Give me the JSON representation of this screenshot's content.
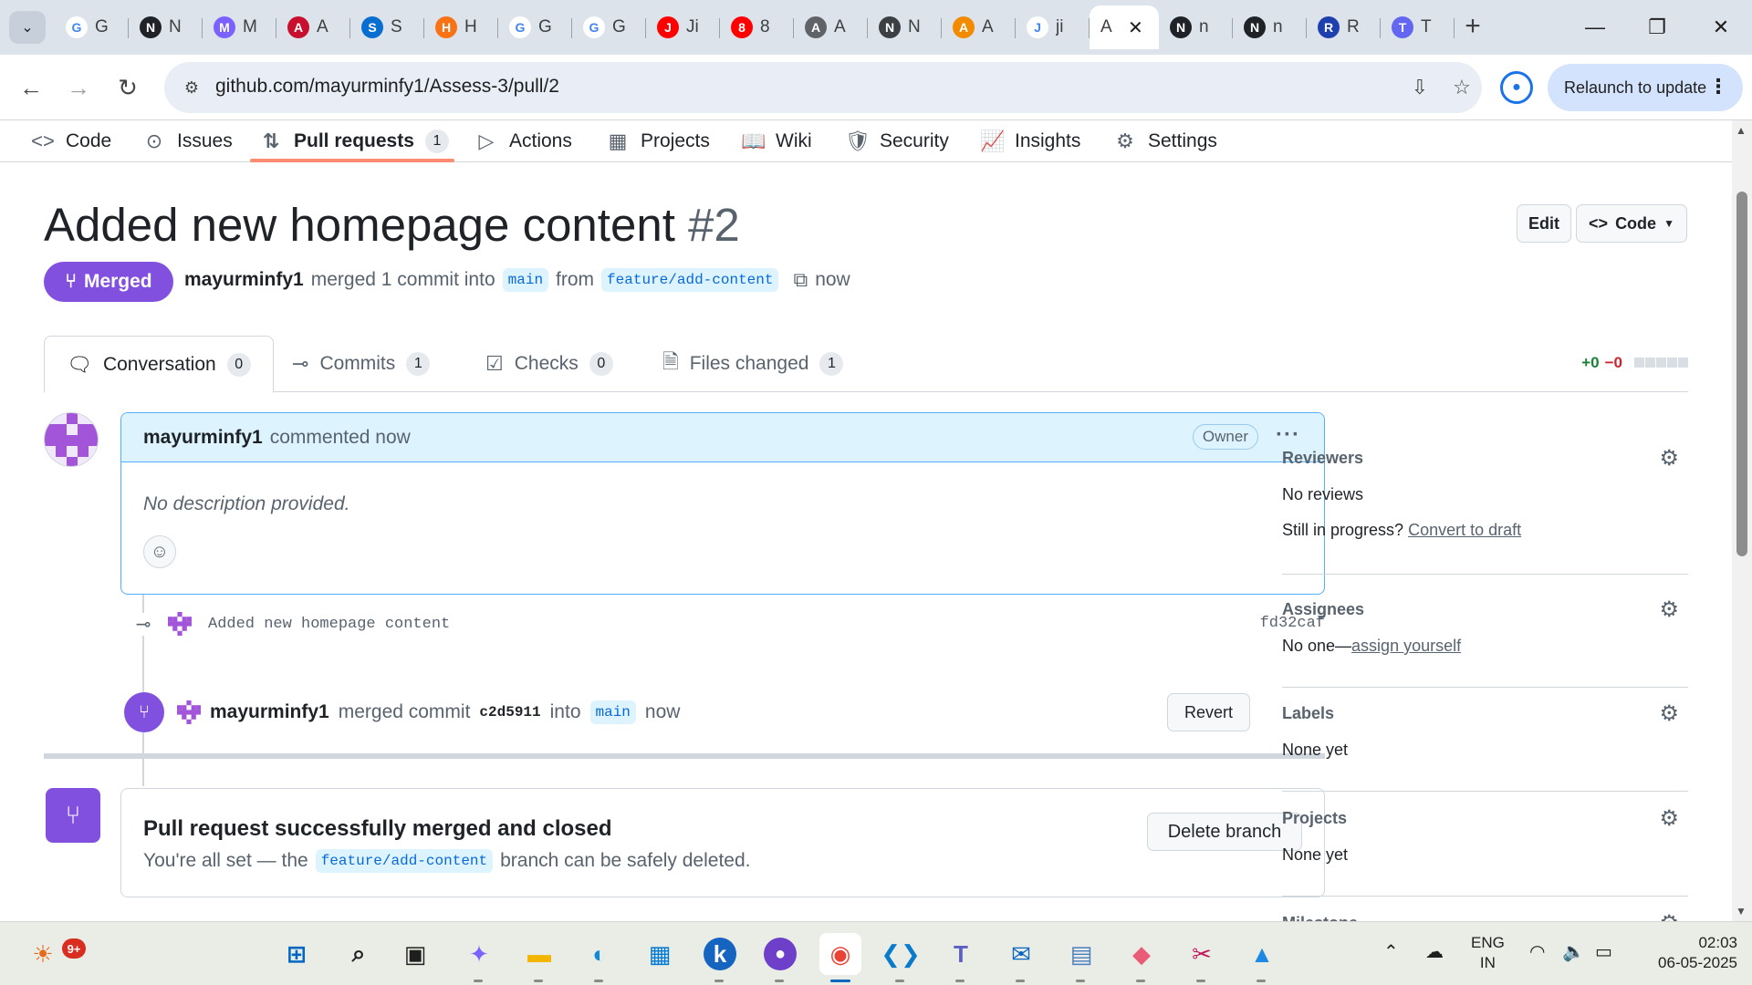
{
  "browser": {
    "tabs": [
      {
        "title": "G",
        "icon": "google-icon",
        "color": "#ffffff",
        "fg": "#4285f4"
      },
      {
        "title": "N",
        "icon": "github-icon",
        "color": "#1f2328",
        "fg": "#ffffff"
      },
      {
        "title": "M",
        "icon": "copilot-icon",
        "color": "#7b61ff",
        "fg": "#ffffff"
      },
      {
        "title": "A",
        "icon": "app-icon",
        "color": "#c8102e",
        "fg": "#ffffff"
      },
      {
        "title": "S",
        "icon": "diamond-icon",
        "color": "#0a6ed1",
        "fg": "#ffffff"
      },
      {
        "title": "H",
        "icon": "flame-icon",
        "color": "#f97316",
        "fg": "#ffffff"
      },
      {
        "title": "G",
        "icon": "google-icon",
        "color": "#ffffff",
        "fg": "#4285f4"
      },
      {
        "title": "G",
        "icon": "google-icon",
        "color": "#ffffff",
        "fg": "#4285f4"
      },
      {
        "title": "Ji",
        "icon": "youtube-icon",
        "color": "#ff0000",
        "fg": "#ffffff"
      },
      {
        "title": "8",
        "icon": "youtube-icon",
        "color": "#ff0000",
        "fg": "#ffffff"
      },
      {
        "title": "A",
        "icon": "globe-icon",
        "color": "#5f6368",
        "fg": "#ffffff"
      },
      {
        "title": "N",
        "icon": "chrome-icon",
        "color": "#3c4043",
        "fg": "#ffffff"
      },
      {
        "title": "A",
        "icon": "box-icon",
        "color": "#f28b00",
        "fg": "#ffffff"
      },
      {
        "title": "ji",
        "icon": "google-icon",
        "color": "#ffffff",
        "fg": "#4285f4"
      }
    ],
    "active_tab": {
      "title": "A",
      "close": "✕"
    },
    "tabs_after": [
      {
        "title": "n",
        "icon": "github-icon",
        "color": "#1f2328",
        "fg": "#ffffff"
      },
      {
        "title": "n",
        "icon": "github-icon",
        "color": "#1f2328",
        "fg": "#ffffff"
      },
      {
        "title": "R",
        "icon": "triangle-icon",
        "color": "#1e40af",
        "fg": "#ffffff"
      },
      {
        "title": "T",
        "icon": "stack-icon",
        "color": "#6366f1",
        "fg": "#ffffff"
      }
    ],
    "url": "github.com/mayurminfy1/Assess-3/pull/2",
    "relaunch_label": "Relaunch to update"
  },
  "repo_nav": {
    "items": [
      {
        "label": "Code",
        "icon": "<>"
      },
      {
        "label": "Issues",
        "icon": "⊙"
      },
      {
        "label": "Pull requests",
        "icon": "⇅",
        "count": "1"
      },
      {
        "label": "Actions",
        "icon": "▷"
      },
      {
        "label": "Projects",
        "icon": "▦"
      },
      {
        "label": "Wiki",
        "icon": "📖"
      },
      {
        "label": "Security",
        "icon": "🛡"
      },
      {
        "label": "Insights",
        "icon": "📈"
      },
      {
        "label": "Settings",
        "icon": "⚙"
      }
    ]
  },
  "pr": {
    "title": "Added new homepage content",
    "number": "#2",
    "edit_label": "Edit",
    "code_label": "Code",
    "state": "Merged",
    "author": "mayurminfy1",
    "meta_merged": "merged 1 commit into",
    "base_branch": "main",
    "meta_from": "from",
    "head_branch": "feature/add-content",
    "time": "now"
  },
  "pr_tabs": {
    "conversation": {
      "label": "Conversation",
      "count": "0"
    },
    "commits": {
      "label": "Commits",
      "count": "1"
    },
    "checks": {
      "label": "Checks",
      "count": "0"
    },
    "files": {
      "label": "Files changed",
      "count": "1"
    },
    "additions": "+0",
    "deletions": "−0"
  },
  "comment": {
    "author": "mayurminfy1",
    "action": "commented now",
    "role": "Owner",
    "body": "No description provided."
  },
  "commit": {
    "message": "Added new homepage content",
    "sha": "fd32caf"
  },
  "merge_event": {
    "author": "mayurminfy1",
    "text": "merged commit",
    "sha": "c2d5911",
    "into": "into",
    "branch": "main",
    "time": "now",
    "revert_label": "Revert"
  },
  "merged_box": {
    "title": "Pull request successfully merged and closed",
    "prefix": "You're all set — the",
    "branch": "feature/add-content",
    "suffix": "branch can be safely deleted.",
    "delete_label": "Delete branch"
  },
  "sidebar": {
    "reviewers": {
      "title": "Reviewers",
      "value": "No reviews",
      "draft_prefix": "Still in progress?",
      "draft_link": "Convert to draft"
    },
    "assignees": {
      "title": "Assignees",
      "value": "No one—",
      "link": "assign yourself"
    },
    "labels": {
      "title": "Labels",
      "value": "None yet"
    },
    "projects": {
      "title": "Projects",
      "value": "None yet"
    },
    "milestone": {
      "title": "Milestone"
    }
  },
  "taskbar": {
    "weather_badge": "9+",
    "lang_top": "ENG",
    "lang_bottom": "IN",
    "time": "02:03",
    "date": "06-05-2025"
  },
  "colors": {
    "merged_purple": "#8250df",
    "link_blue": "#0969da",
    "tab_underline": "#fd8c73"
  }
}
